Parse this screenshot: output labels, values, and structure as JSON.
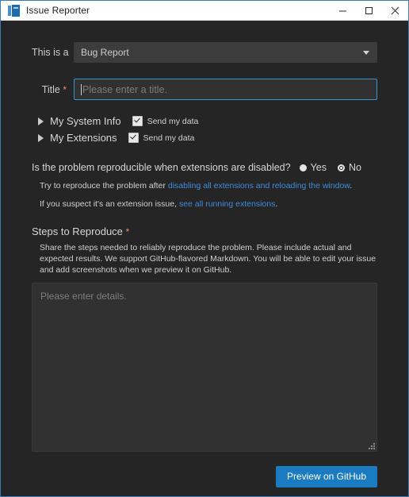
{
  "window": {
    "title": "Issue Reporter",
    "icon": "vscode-icon",
    "controls": {
      "minimize": "minimize",
      "maximize": "maximize",
      "close": "close"
    },
    "border_color": "#3a7cb8",
    "titlebar_bg": "#ffffff",
    "body_bg": "#252526"
  },
  "form": {
    "type_label": "This is a",
    "type_value": "Bug Report",
    "title_label": "Title",
    "title_required_marker": "*",
    "title_value": "",
    "title_placeholder": "Please enter a title.",
    "sections": [
      {
        "name": "My System Info",
        "checkbox_label": "Send my data",
        "checked": true
      },
      {
        "name": "My Extensions",
        "checkbox_label": "Send my data",
        "checked": true
      }
    ],
    "question": {
      "text": "Is the problem reproducible when extensions are disabled?",
      "options": [
        {
          "label": "Yes",
          "selected": false
        },
        {
          "label": "No",
          "selected": true
        }
      ]
    },
    "hints": [
      {
        "prefix": "Try to reproduce the problem after ",
        "link": "disabling all extensions and reloading the window",
        "suffix": "."
      },
      {
        "prefix": "If you suspect it's an extension issue, ",
        "link": "see all running extensions",
        "suffix": "."
      }
    ],
    "steps": {
      "label": "Steps to Reproduce",
      "required_marker": "*",
      "description": "Share the steps needed to reliably reproduce the problem. Please include actual and expected results. We support GitHub-flavored Markdown. You will be able to edit your issue and add screenshots when we preview it on GitHub.",
      "value": "",
      "placeholder": "Please enter details."
    },
    "submit_label": "Preview on GitHub",
    "accent_color": "#1a7bc1",
    "link_color": "#3f8bdc",
    "required_color": "#f48771"
  }
}
